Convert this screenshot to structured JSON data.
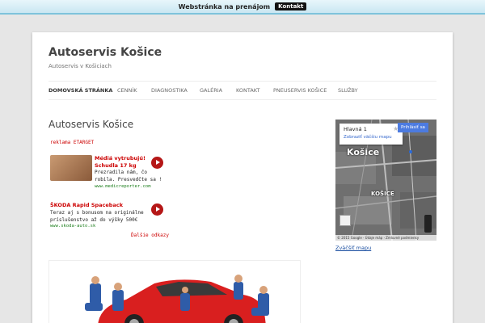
{
  "topbar": {
    "text": "Webstránka na prenájom",
    "button": "Kontakt"
  },
  "site": {
    "title": "Autoservis Košice",
    "description": "Autoservis v Košiciach"
  },
  "nav": [
    {
      "label": "DOMOVSKÁ STRÁNKA",
      "active": true
    },
    {
      "label": "CENNÍK"
    },
    {
      "label": "DIAGNOSTIKA"
    },
    {
      "label": "GALÉRIA"
    },
    {
      "label": "KONTAKT"
    },
    {
      "label": "PNEUSERVIS KOŠICE"
    },
    {
      "label": "SLUŽBY"
    }
  ],
  "entry": {
    "title": "Autoservis Košice"
  },
  "ads": {
    "label": "reklama ETARGET",
    "items": [
      {
        "title": "Médiá vytrubujú!",
        "subtitle": "Schudla 17 kg",
        "text1": "Prezradila nám, čo",
        "text2": "robila. Presvedčte sa !",
        "url": "www.medicreporter.com"
      },
      {
        "title": "ŠKODA Rapid Spaceback",
        "text1": "Teraz aj s bonusom na originálne",
        "text2": "príslušenstvo až do výšky 500€",
        "url": "www.skoda-auto.sk"
      }
    ],
    "more": "Ďalšie odkazy"
  },
  "map": {
    "place": "Hlavná 1",
    "larger_map_link": "Zobraziť väčšiu mapu",
    "save_button": "Prihlásiť sa",
    "city_label": "Košice",
    "district_label": "KOŠICE",
    "footer": "© 2015 Google · Údaje máp · Zmluvné podmienky",
    "enlarge": "Zväčšiť mapu"
  },
  "colors": {
    "accent": "#cc0000",
    "link": "#1a4ea0",
    "topbar": "#c9e7f2"
  }
}
